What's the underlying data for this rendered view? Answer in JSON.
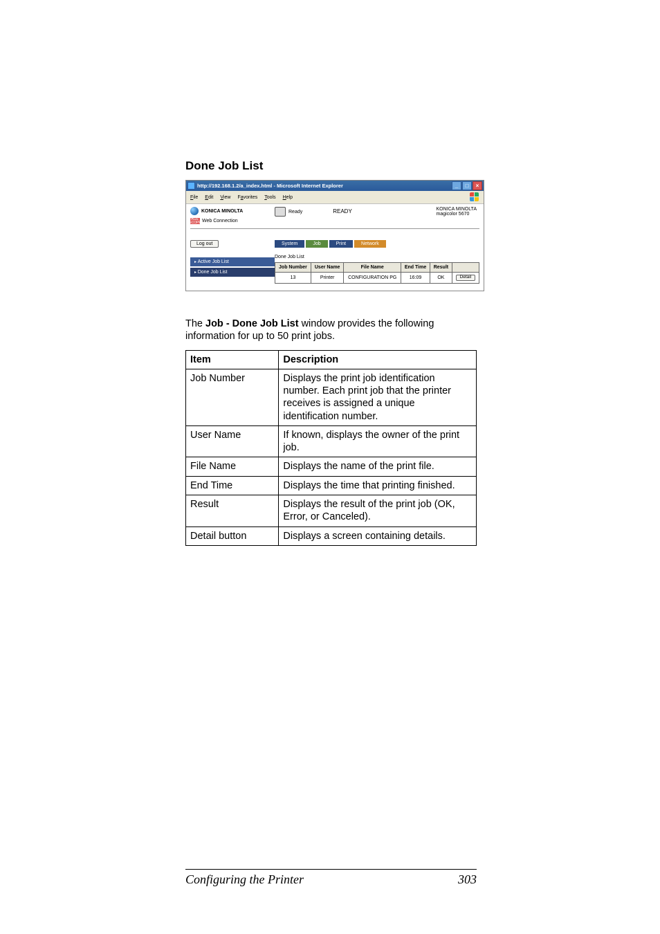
{
  "section_heading": "Done Job List",
  "ie_window": {
    "title": "http://192.168.1.2/a_index.html - Microsoft Internet Explorer",
    "menu": [
      "File",
      "Edit",
      "View",
      "Favorites",
      "Tools",
      "Help"
    ],
    "brand": "KONICA MINOLTA",
    "pagescope_badge": "PAGE SCOPE",
    "webconn_label": "Web Connection",
    "ready_label": "Ready",
    "status_text": "READY",
    "device_line1": "KONICA MINOLTA",
    "device_line2": "magicolor 5670",
    "logout": "Log out",
    "tabs": {
      "system": "System",
      "job": "Job",
      "print": "Print",
      "network": "Network"
    },
    "sidebar": {
      "active": "Active Job List",
      "done": "Done Job List"
    },
    "panel_title": "Done Job List",
    "cols": {
      "num": "Job Number",
      "user": "User Name",
      "file": "File Name",
      "end": "End Time",
      "result": "Result"
    },
    "row": {
      "num": "13",
      "user": "Printer",
      "file": "CONFIGURATION PG",
      "end": "16:09",
      "result": "OK",
      "detail": "Detail"
    }
  },
  "body_para_pre": "The ",
  "body_para_bold": "Job - Done Job List",
  "body_para_post": " window provides the following information for up to 50 print jobs.",
  "table": {
    "head_item": "Item",
    "head_desc": "Description",
    "rows": [
      {
        "item": "Job Number",
        "desc": "Displays the print job identification number. Each print job that the printer receives is assigned a unique identification number."
      },
      {
        "item": "User Name",
        "desc": "If known, displays the owner of the print job."
      },
      {
        "item": "File Name",
        "desc": "Displays the name of the print file."
      },
      {
        "item": "End Time",
        "desc": "Displays the time that printing finished."
      },
      {
        "item": "Result",
        "desc": "Displays the result of the print job (OK, Error, or Canceled)."
      },
      {
        "item": "Detail button",
        "desc": "Displays a screen containing details."
      }
    ]
  },
  "footer_text": "Configuring the Printer",
  "page_number": "303"
}
